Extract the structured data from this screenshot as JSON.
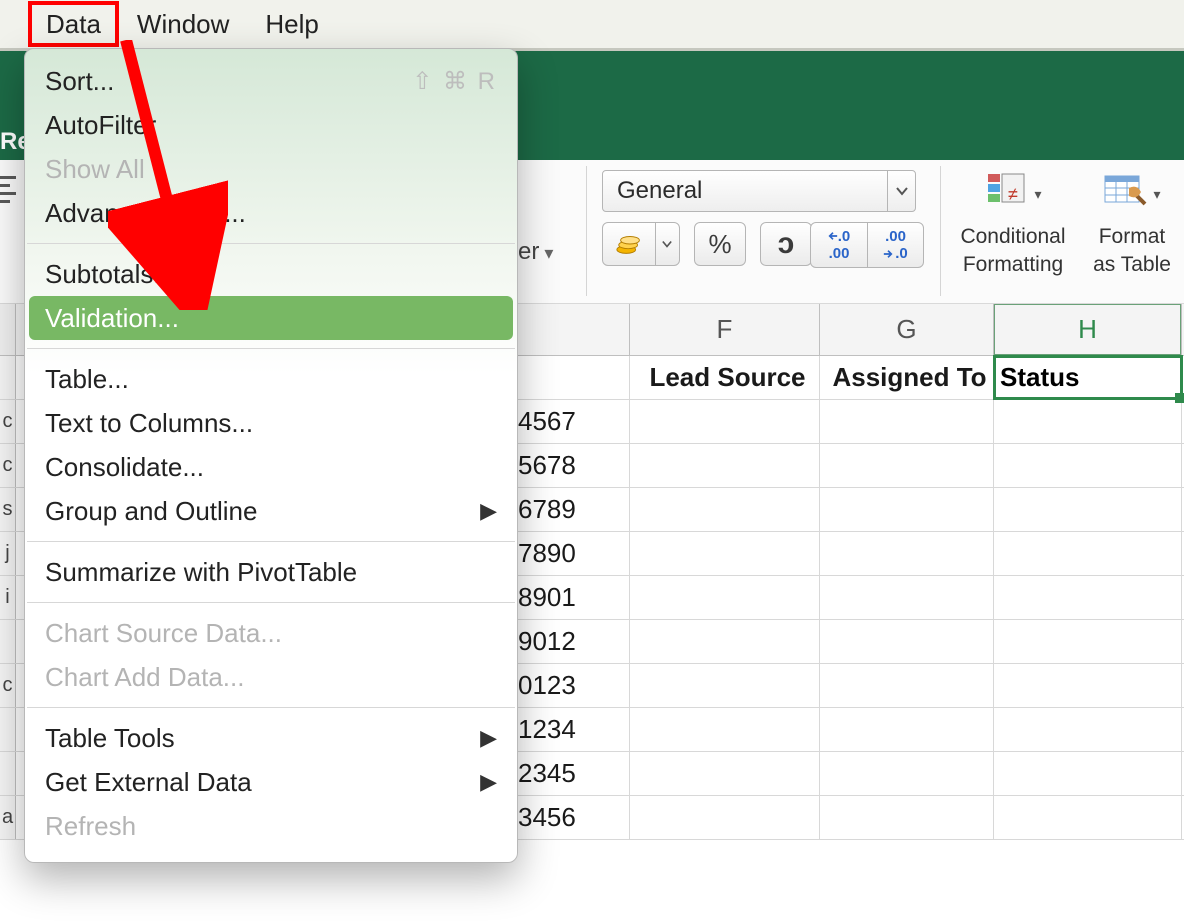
{
  "menubar": {
    "items": [
      {
        "label": "Data",
        "active": true
      },
      {
        "label": "Window",
        "active": false
      },
      {
        "label": "Help",
        "active": false
      }
    ]
  },
  "ribbon": {
    "left_partial_label": "Re"
  },
  "toolbar": {
    "er_partial_label": "er",
    "number_format": "General",
    "conditional_formatting": {
      "line1": "Conditional",
      "line2": "Formatting"
    },
    "format_as_table": {
      "line1": "Format",
      "line2": "as Table"
    },
    "decrease_decimal": {
      "top": ".0",
      "bot": ".00"
    },
    "increase_decimal": {
      "top": ".00",
      "bot": ".0"
    }
  },
  "data_menu": {
    "sort": "Sort...",
    "sort_shortcut": "⇧ ⌘ R",
    "autofilter": "AutoFilter",
    "show_all": "Show All",
    "advanced_filter": "Advanced Filter...",
    "subtotals": "Subtotals...",
    "validation": "Validation...",
    "table": "Table...",
    "text_to_columns": "Text to Columns...",
    "consolidate": "Consolidate...",
    "group_outline": "Group and Outline",
    "summarize_pivot": "Summarize with PivotTable",
    "chart_source": "Chart Source Data...",
    "chart_add": "Chart Add Data...",
    "table_tools": "Table Tools",
    "get_external": "Get External Data",
    "refresh": "Refresh"
  },
  "columns": {
    "F": "F",
    "G": "G",
    "H": "H"
  },
  "headers": {
    "lead_source": "Lead Source",
    "assigned_to": "Assigned To",
    "status": "Status"
  },
  "partial_values": {
    "rows": [
      "4567",
      "5678",
      "6789",
      "7890",
      "8901",
      "9012",
      "0123",
      "1234",
      "2345",
      "3456"
    ]
  },
  "row_gutter_chars": [
    "c",
    "c",
    "s",
    "j",
    "i",
    " ",
    "c",
    " ",
    " ",
    "a"
  ]
}
